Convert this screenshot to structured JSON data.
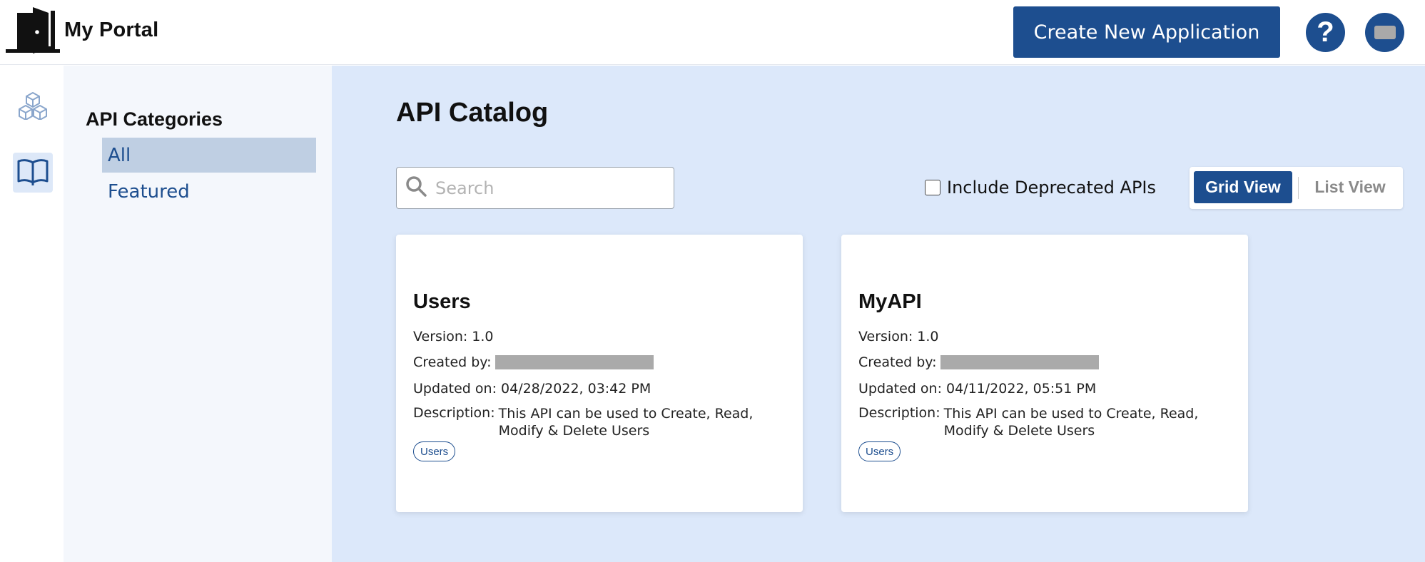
{
  "header": {
    "brand": "My Portal",
    "create_button": "Create New Application",
    "help_label": "?"
  },
  "rail": {
    "items": [
      {
        "icon": "cubes-icon",
        "active": false
      },
      {
        "icon": "book-icon",
        "active": true
      }
    ]
  },
  "categories": {
    "title": "API Categories",
    "items": [
      {
        "label": "All",
        "active": true
      },
      {
        "label": "Featured",
        "active": false
      }
    ]
  },
  "main": {
    "title": "API Catalog",
    "search_placeholder": "Search",
    "deprecated_label": "Include Deprecated APIs",
    "deprecated_checked": false,
    "grid_view": "Grid View",
    "list_view": "List View"
  },
  "cards": [
    {
      "name": "Users",
      "version": "Version: 1.0",
      "created_by_label": "Created by:",
      "updated": "Updated on: 04/28/2022, 03:42 PM",
      "description_label": "Description:",
      "description": "This API can be used to Create, Read, Modify & Delete Users",
      "tag": "Users"
    },
    {
      "name": "MyAPI",
      "version": "Version: 1.0",
      "created_by_label": "Created by:",
      "updated": "Updated on: 04/11/2022, 05:51 PM",
      "description_label": "Description:",
      "description": "This API can be used to Create, Read, Modify & Delete Users",
      "tag": "Users"
    }
  ],
  "colors": {
    "primary": "#1d4e8f",
    "main_bg": "#dce8fa",
    "panel_bg": "#f4f7fc",
    "active_category_bg": "#bfcfe3"
  }
}
